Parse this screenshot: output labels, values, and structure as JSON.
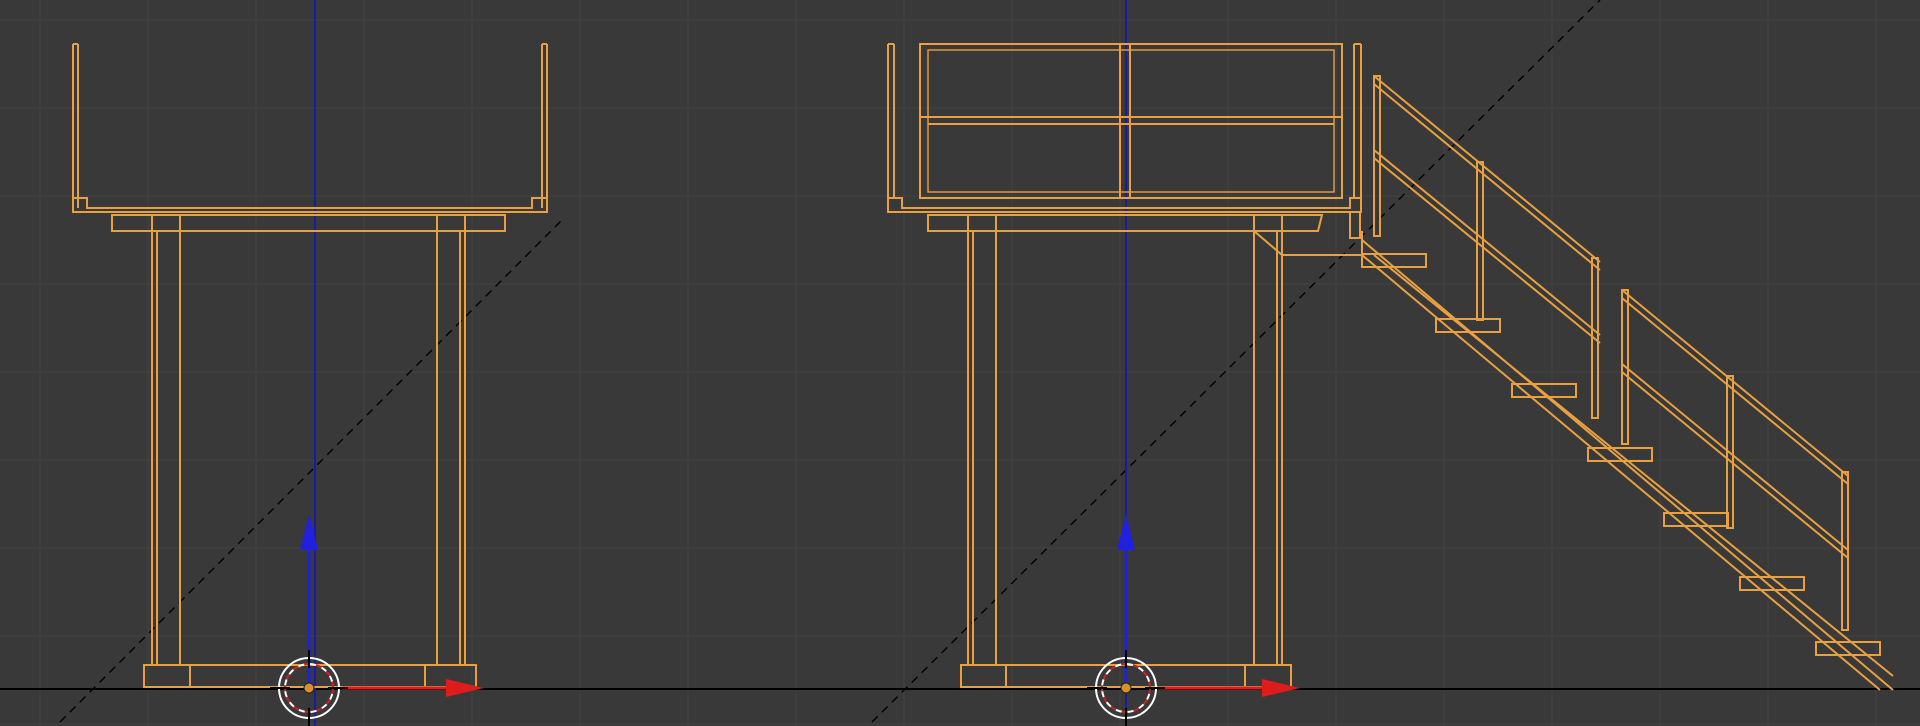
{
  "viewport": {
    "view": "front-orthographic",
    "shading": "wireframe",
    "colors": {
      "background": "#393939",
      "grid": "#444444",
      "selected_wire": "#e8a040",
      "axis_z": "#1a1aa8",
      "axis_x_horizon": "#000000",
      "gizmo_z": "#2020dd",
      "gizmo_x": "#dd1c1c",
      "cursor_ring": "#ffffff",
      "cursor_dash": "#cc2222",
      "origin_dot": "#d8902a"
    },
    "objects": [
      {
        "name": "platform-without-stairs",
        "selected": true,
        "icon": "mesh-object"
      },
      {
        "name": "platform-with-stairs",
        "selected": true,
        "icon": "mesh-object"
      }
    ],
    "icons": [
      "3d-cursor-icon",
      "move-gizmo-z-arrow-icon",
      "move-gizmo-x-arrow-icon",
      "object-origin-icon"
    ]
  }
}
